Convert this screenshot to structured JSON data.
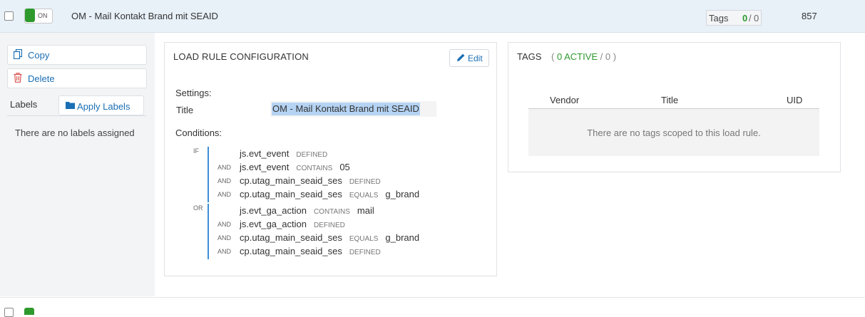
{
  "rule_row": {
    "toggle_label": "ON",
    "name": "OM - Mail Kontakt Brand mit SEAID",
    "tags_label": "Tags",
    "tags_active": "0",
    "tags_separator": "/",
    "tags_total": "0",
    "rule_id": "857"
  },
  "sidebar": {
    "copy_label": "Copy",
    "delete_label": "Delete",
    "labels_label": "Labels",
    "apply_labels_label": "Apply Labels",
    "no_labels_text": "There are no labels assigned"
  },
  "load_rule": {
    "title": "LOAD RULE CONFIGURATION",
    "edit_label": "Edit",
    "settings_label": "Settings:",
    "title_label": "Title",
    "title_value": "OM - Mail Kontakt Brand mit SEAID",
    "conditions_label": "Conditions:",
    "groups": [
      {
        "keyword": "IF",
        "conditions": [
          {
            "conj": "",
            "var": "js.evt_event",
            "op": "DEFINED",
            "val": ""
          },
          {
            "conj": "AND",
            "var": "js.evt_event",
            "op": "CONTAINS",
            "val": "05"
          },
          {
            "conj": "AND",
            "var": "cp.utag_main_seaid_ses",
            "op": "DEFINED",
            "val": ""
          },
          {
            "conj": "AND",
            "var": "cp.utag_main_seaid_ses",
            "op": "EQUALS",
            "val": "g_brand"
          }
        ]
      },
      {
        "keyword": "OR",
        "conditions": [
          {
            "conj": "",
            "var": "js.evt_ga_action",
            "op": "CONTAINS",
            "val": "mail"
          },
          {
            "conj": "AND",
            "var": "js.evt_ga_action",
            "op": "DEFINED",
            "val": ""
          },
          {
            "conj": "AND",
            "var": "cp.utag_main_seaid_ses",
            "op": "EQUALS",
            "val": "g_brand"
          },
          {
            "conj": "AND",
            "var": "cp.utag_main_seaid_ses",
            "op": "DEFINED",
            "val": ""
          }
        ]
      }
    ]
  },
  "tags_panel": {
    "title": "TAGS",
    "open_paren": "(",
    "active_text": "0 ACTIVE",
    "total_text": "/ 0 )",
    "columns": [
      "Vendor",
      "Title",
      "UID"
    ],
    "empty_text": "There are no tags scoped to this load rule."
  },
  "colors": {
    "accent_blue": "#1a6fb5",
    "active_green": "#2e9a2e",
    "condition_bar": "#3c8ed3",
    "selection_highlight": "#b5d3f3"
  },
  "icons": {
    "copy": "copy-icon",
    "delete": "trash-icon",
    "apply_labels": "folder-icon",
    "edit": "pencil-icon"
  }
}
